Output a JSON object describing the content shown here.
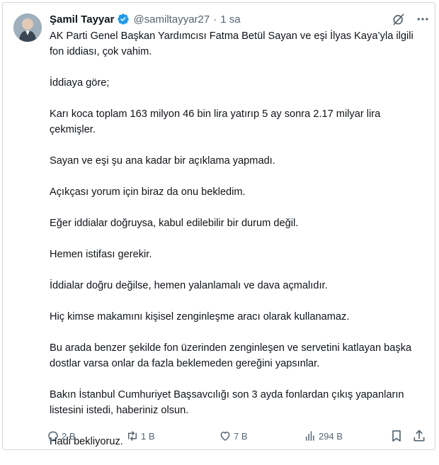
{
  "tweet": {
    "author": {
      "name": "Şamil Tayyar",
      "handle": "@samiltayyar27",
      "verified": true
    },
    "separator": "·",
    "time": "1 sa",
    "paragraphs": [
      "AK Parti Genel Başkan Yardımcısı Fatma Betül Sayan ve eşi İlyas Kaya’yla ilgili fon iddiası, çok vahim.",
      "İddiaya göre;",
      "Karı koca toplam 163 milyon 46 bin lira yatırıp 5 ay sonra 2.17 milyar lira çekmişler.",
      "Sayan ve eşi şu ana kadar bir açıklama yapmadı.",
      "Açıkçası yorum için biraz da onu bekledim.",
      "Eğer iddialar doğruysa, kabul edilebilir bir durum değil.",
      "Hemen istifası gerekir.",
      "İddialar doğru değilse, hemen yalanlamalı ve dava açmalıdır.",
      "Hiç kimse makamını kişisel zenginleşme aracı olarak kullanamaz.",
      "Bu arada benzer şekilde fon üzerinden zenginleşen ve servetini katlayan başka dostlar varsa onlar da fazla beklemeden gereğini yapsınlar.",
      "Bakın İstanbul Cumhuriyet Başsavcılığı son 3 ayda fonlardan çıkış yapanların listesini istedi, haberiniz olsun.",
      "Hadi bekliyoruz."
    ],
    "stats": {
      "replies": "2 B",
      "reposts": "1 B",
      "likes": "7 B",
      "views": "294 B"
    }
  },
  "icons": {
    "verified": "verified-badge-icon",
    "grok": "grok-icon",
    "more": "more-icon",
    "reply": "reply-icon",
    "repost": "repost-icon",
    "like": "heart-icon",
    "views": "views-icon",
    "bookmark": "bookmark-icon",
    "share": "share-icon"
  },
  "colors": {
    "text": "#0f1419",
    "secondary": "#536471",
    "verified": "#1d9bf0",
    "border": "#cfd9de"
  }
}
